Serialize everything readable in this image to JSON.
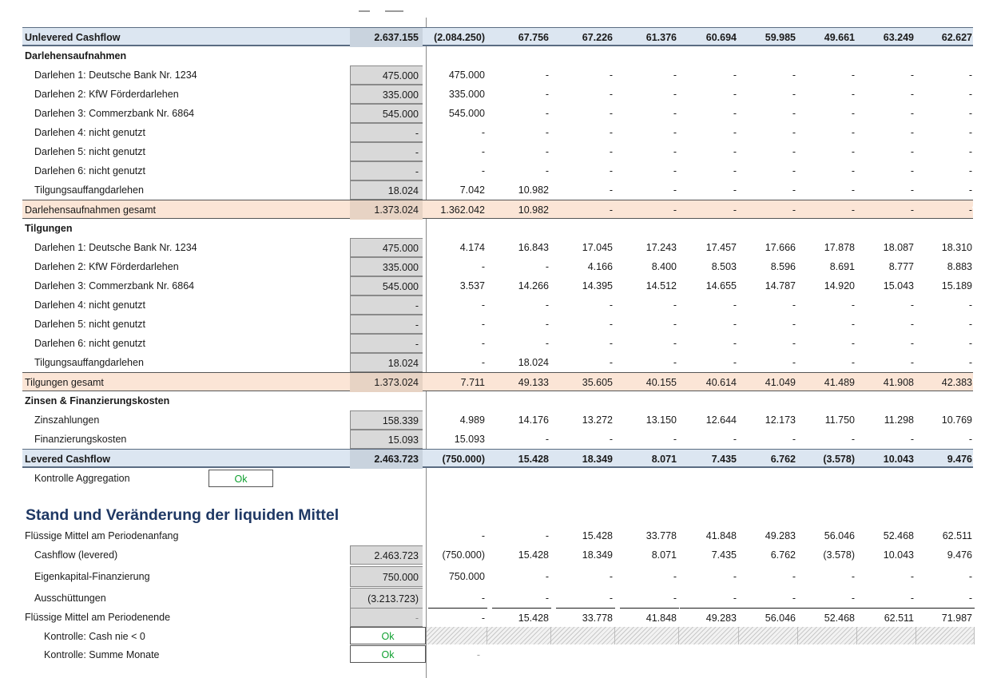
{
  "blocks": [
    {
      "type": "row",
      "style": "blue",
      "label": "Unlevered Cashflow",
      "total": "2.637.155",
      "months": [
        "(2.084.250)",
        "67.756",
        "67.226",
        "61.376",
        "60.694",
        "59.985",
        "49.661",
        "63.249",
        "62.627"
      ]
    },
    {
      "type": "header",
      "label": "Darlehensaufnahmen"
    },
    {
      "type": "row",
      "indent": 1,
      "grayTotal": true,
      "label": "Darlehen 1: Deutsche Bank Nr. 1234",
      "total": "475.000",
      "months": [
        "475.000",
        "-",
        "-",
        "-",
        "-",
        "-",
        "-",
        "-",
        "-"
      ]
    },
    {
      "type": "row",
      "indent": 1,
      "grayTotal": true,
      "label": "Darlehen 2: KfW Förderdarlehen",
      "total": "335.000",
      "months": [
        "335.000",
        "-",
        "-",
        "-",
        "-",
        "-",
        "-",
        "-",
        "-"
      ]
    },
    {
      "type": "row",
      "indent": 1,
      "grayTotal": true,
      "label": "Darlehen 3: Commerzbank Nr. 6864",
      "total": "545.000",
      "months": [
        "545.000",
        "-",
        "-",
        "-",
        "-",
        "-",
        "-",
        "-",
        "-"
      ]
    },
    {
      "type": "row",
      "indent": 1,
      "grayTotal": true,
      "label": "Darlehen 4: nicht genutzt",
      "total": "-",
      "months": [
        "-",
        "-",
        "-",
        "-",
        "-",
        "-",
        "-",
        "-",
        "-"
      ]
    },
    {
      "type": "row",
      "indent": 1,
      "grayTotal": true,
      "label": "Darlehen 5: nicht genutzt",
      "total": "-",
      "months": [
        "-",
        "-",
        "-",
        "-",
        "-",
        "-",
        "-",
        "-",
        "-"
      ]
    },
    {
      "type": "row",
      "indent": 1,
      "grayTotal": true,
      "label": "Darlehen 6: nicht genutzt",
      "total": "-",
      "months": [
        "-",
        "-",
        "-",
        "-",
        "-",
        "-",
        "-",
        "-",
        "-"
      ]
    },
    {
      "type": "row",
      "indent": 1,
      "grayTotal": true,
      "label": "Tilgungsauffangdarlehen",
      "total": "18.024",
      "months": [
        "7.042",
        "10.982",
        "-",
        "-",
        "-",
        "-",
        "-",
        "-",
        "-"
      ]
    },
    {
      "type": "row",
      "style": "peach",
      "label": "Darlehensaufnahmen gesamt",
      "total": "1.373.024",
      "months": [
        "1.362.042",
        "10.982",
        "-",
        "-",
        "-",
        "-",
        "-",
        "-",
        "-"
      ]
    },
    {
      "type": "header",
      "label": "Tilgungen"
    },
    {
      "type": "row",
      "indent": 1,
      "grayTotal": true,
      "label": "Darlehen 1: Deutsche Bank Nr. 1234",
      "total": "475.000",
      "months": [
        "4.174",
        "16.843",
        "17.045",
        "17.243",
        "17.457",
        "17.666",
        "17.878",
        "18.087",
        "18.310"
      ]
    },
    {
      "type": "row",
      "indent": 1,
      "grayTotal": true,
      "label": "Darlehen 2: KfW Förderdarlehen",
      "total": "335.000",
      "months": [
        "-",
        "-",
        "4.166",
        "8.400",
        "8.503",
        "8.596",
        "8.691",
        "8.777",
        "8.883"
      ]
    },
    {
      "type": "row",
      "indent": 1,
      "grayTotal": true,
      "label": "Darlehen 3: Commerzbank Nr. 6864",
      "total": "545.000",
      "months": [
        "3.537",
        "14.266",
        "14.395",
        "14.512",
        "14.655",
        "14.787",
        "14.920",
        "15.043",
        "15.189"
      ]
    },
    {
      "type": "row",
      "indent": 1,
      "grayTotal": true,
      "label": "Darlehen 4: nicht genutzt",
      "total": "-",
      "months": [
        "-",
        "-",
        "-",
        "-",
        "-",
        "-",
        "-",
        "-",
        "-"
      ]
    },
    {
      "type": "row",
      "indent": 1,
      "grayTotal": true,
      "label": "Darlehen 5: nicht genutzt",
      "total": "-",
      "months": [
        "-",
        "-",
        "-",
        "-",
        "-",
        "-",
        "-",
        "-",
        "-"
      ]
    },
    {
      "type": "row",
      "indent": 1,
      "grayTotal": true,
      "label": "Darlehen 6: nicht genutzt",
      "total": "-",
      "months": [
        "-",
        "-",
        "-",
        "-",
        "-",
        "-",
        "-",
        "-",
        "-"
      ]
    },
    {
      "type": "row",
      "indent": 1,
      "grayTotal": true,
      "label": "Tilgungsauffangdarlehen",
      "total": "18.024",
      "months": [
        "-",
        "18.024",
        "-",
        "-",
        "-",
        "-",
        "-",
        "-",
        "-"
      ]
    },
    {
      "type": "row",
      "style": "peach",
      "label": "Tilgungen gesamt",
      "total": "1.373.024",
      "months": [
        "7.711",
        "49.133",
        "35.605",
        "40.155",
        "40.614",
        "41.049",
        "41.489",
        "41.908",
        "42.383"
      ]
    },
    {
      "type": "header",
      "label": "Zinsen & Finanzierungskosten"
    },
    {
      "type": "row",
      "indent": 1,
      "grayTotal": true,
      "label": "Zinszahlungen",
      "total": "158.339",
      "months": [
        "4.989",
        "14.176",
        "13.272",
        "13.150",
        "12.644",
        "12.173",
        "11.750",
        "11.298",
        "10.769"
      ]
    },
    {
      "type": "row",
      "indent": 1,
      "grayTotal": true,
      "label": "Finanzierungskosten",
      "total": "15.093",
      "months": [
        "15.093",
        "-",
        "-",
        "-",
        "-",
        "-",
        "-",
        "-",
        "-"
      ]
    },
    {
      "type": "row",
      "style": "blue",
      "label": "Levered Cashflow",
      "total": "2.463.723",
      "months": [
        "(750.000)",
        "15.428",
        "18.349",
        "8.071",
        "7.435",
        "6.762",
        "(3.578)",
        "10.043",
        "9.476"
      ]
    }
  ],
  "kontrolle_aggregation": {
    "label": "Kontrolle Aggregation",
    "status": "Ok"
  },
  "section_title": "Stand und Veränderung der liquiden Mittel",
  "liquid": {
    "opening": {
      "label": "Flüssige Mittel am Periodenanfang",
      "total": "",
      "months": [
        "-",
        "-",
        "15.428",
        "33.778",
        "41.848",
        "49.283",
        "56.046",
        "52.468",
        "62.511"
      ]
    },
    "cashflow": {
      "label": "Cashflow (levered)",
      "total": "2.463.723",
      "months": [
        "(750.000)",
        "15.428",
        "18.349",
        "8.071",
        "7.435",
        "6.762",
        "(3.578)",
        "10.043",
        "9.476"
      ]
    },
    "equity": {
      "label": "Eigenkapital-Finanzierung",
      "total": "750.000",
      "months": [
        "750.000",
        "-",
        "-",
        "-",
        "-",
        "-",
        "-",
        "-",
        "-"
      ]
    },
    "payout": {
      "label": "Ausschüttungen",
      "total": "(3.213.723)",
      "months": [
        "-",
        "-",
        "-",
        "-",
        "-",
        "-",
        "-",
        "-",
        "-"
      ]
    },
    "closing": {
      "label": "Flüssige Mittel am Periodenende",
      "total": "-",
      "months": [
        "-",
        "15.428",
        "33.778",
        "41.848",
        "49.283",
        "56.046",
        "52.468",
        "62.511",
        "71.987"
      ]
    }
  },
  "checks": {
    "cash": {
      "label": "Kontrolle: Cash nie < 0",
      "status": "Ok"
    },
    "sum": {
      "label": "Kontrolle: Summe Monate",
      "status": "Ok",
      "month_value": "-"
    }
  },
  "colors": {
    "blue_row": "#dce6f1",
    "peach_row": "#fbe5d6",
    "title": "#1f3864",
    "ok": "#10a030",
    "gray_cell": "#d9d9d9"
  }
}
